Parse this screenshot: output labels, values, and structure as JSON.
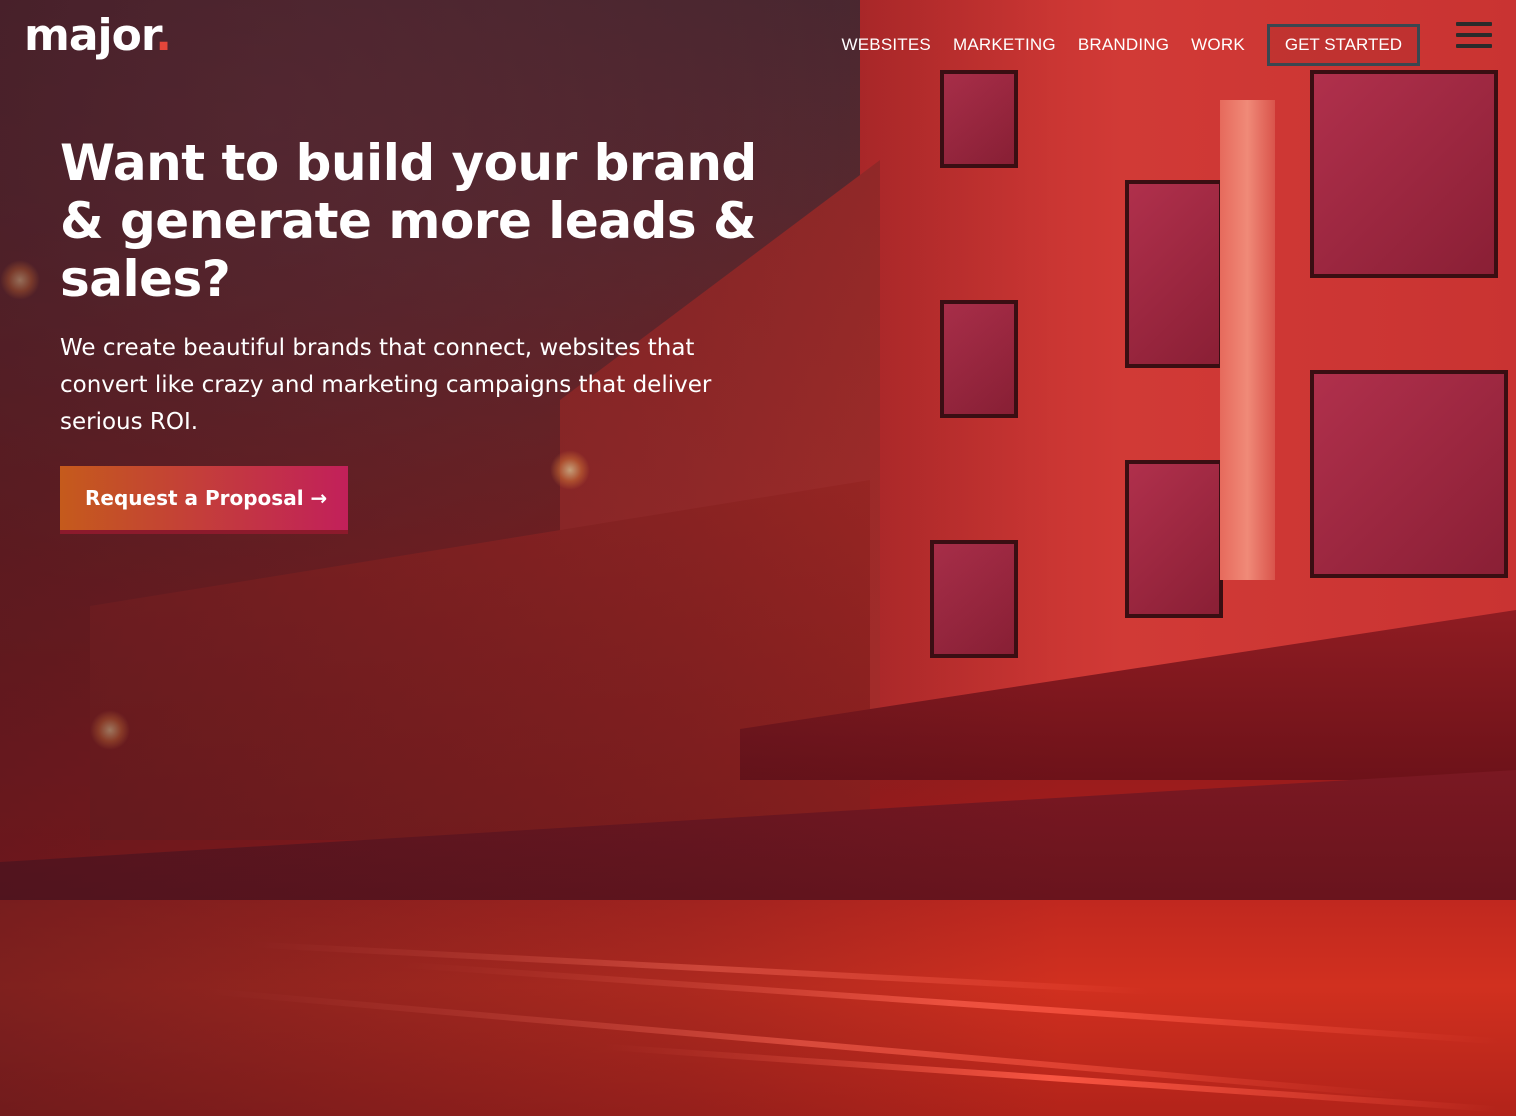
{
  "header": {
    "logo_text": "major",
    "logo_dot": ".",
    "nav": [
      {
        "label": "WEBSITES"
      },
      {
        "label": "MARKETING"
      },
      {
        "label": "BRANDING"
      },
      {
        "label": "WORK"
      }
    ],
    "cta_label": "GET STARTED"
  },
  "hero": {
    "headline": "Want to build your brand & generate more leads & sales?",
    "subheadline": "We create beautiful brands that connect, websites that convert like crazy and marketing campaigns that deliver serious ROI.",
    "button_label": "Request a Proposal →"
  },
  "colors": {
    "accent": "#e3463a",
    "button_start": "#c55a1c",
    "button_end": "#c2205a"
  },
  "icons": [
    "menu-icon",
    "arrow-right-icon"
  ]
}
